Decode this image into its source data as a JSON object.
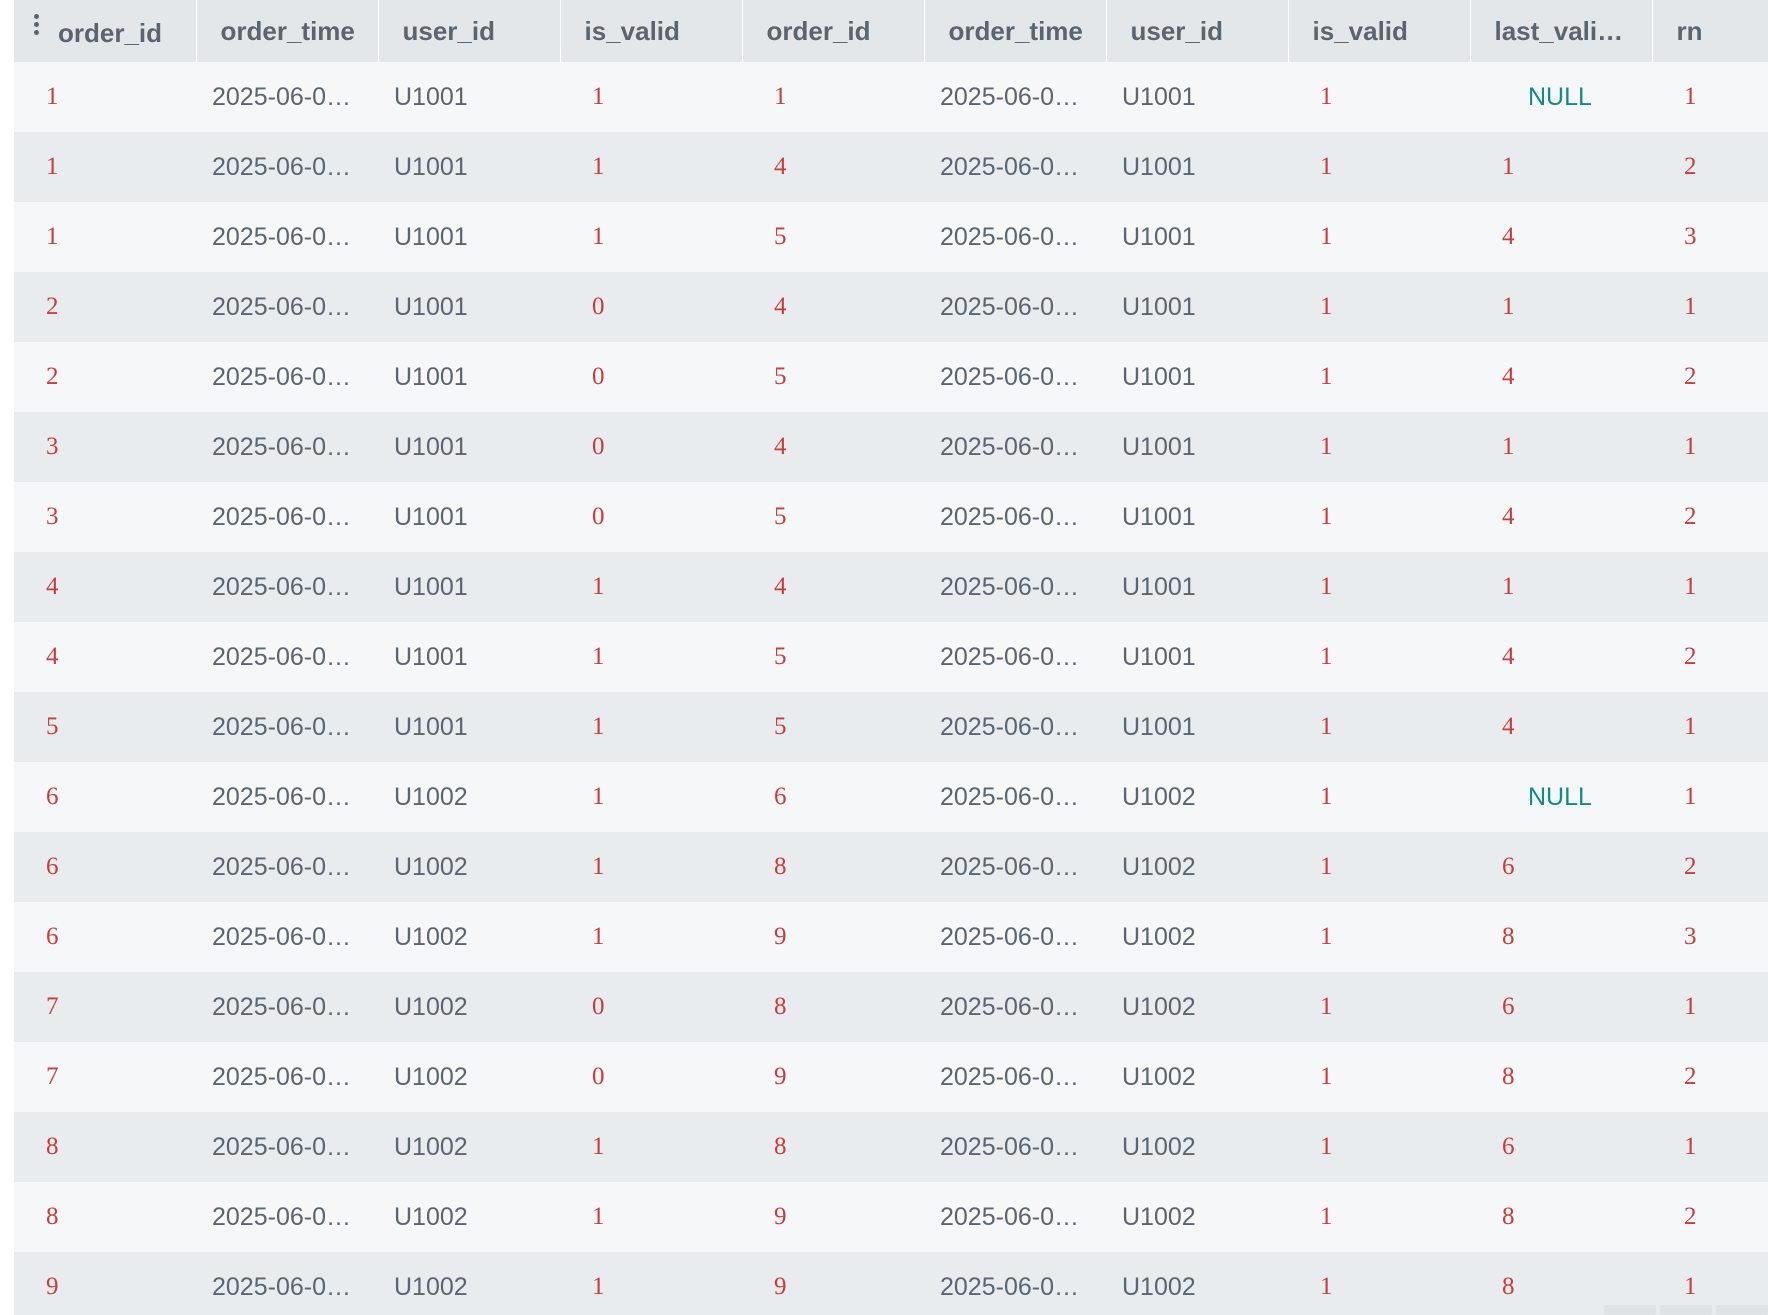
{
  "columns": [
    "order_id",
    "order_time",
    "user_id",
    "is_valid",
    "order_id",
    "order_time",
    "user_id",
    "is_valid",
    "last_vali…",
    "rn"
  ],
  "column_types": [
    "num",
    "txt",
    "txt",
    "num",
    "num",
    "txt",
    "txt",
    "num",
    "num",
    "num"
  ],
  "null_label": "NULL",
  "colors": {
    "number": "#cc3b3b",
    "text": "#5b6570",
    "null": "#138a8a",
    "header_bg": "#e4e7ea"
  },
  "rows": [
    [
      "1",
      "2025-06-0…",
      "U1001",
      "1",
      "1",
      "2025-06-0…",
      "U1001",
      "1",
      null,
      "1"
    ],
    [
      "1",
      "2025-06-0…",
      "U1001",
      "1",
      "4",
      "2025-06-0…",
      "U1001",
      "1",
      "1",
      "2"
    ],
    [
      "1",
      "2025-06-0…",
      "U1001",
      "1",
      "5",
      "2025-06-0…",
      "U1001",
      "1",
      "4",
      "3"
    ],
    [
      "2",
      "2025-06-0…",
      "U1001",
      "0",
      "4",
      "2025-06-0…",
      "U1001",
      "1",
      "1",
      "1"
    ],
    [
      "2",
      "2025-06-0…",
      "U1001",
      "0",
      "5",
      "2025-06-0…",
      "U1001",
      "1",
      "4",
      "2"
    ],
    [
      "3",
      "2025-06-0…",
      "U1001",
      "0",
      "4",
      "2025-06-0…",
      "U1001",
      "1",
      "1",
      "1"
    ],
    [
      "3",
      "2025-06-0…",
      "U1001",
      "0",
      "5",
      "2025-06-0…",
      "U1001",
      "1",
      "4",
      "2"
    ],
    [
      "4",
      "2025-06-0…",
      "U1001",
      "1",
      "4",
      "2025-06-0…",
      "U1001",
      "1",
      "1",
      "1"
    ],
    [
      "4",
      "2025-06-0…",
      "U1001",
      "1",
      "5",
      "2025-06-0…",
      "U1001",
      "1",
      "4",
      "2"
    ],
    [
      "5",
      "2025-06-0…",
      "U1001",
      "1",
      "5",
      "2025-06-0…",
      "U1001",
      "1",
      "4",
      "1"
    ],
    [
      "6",
      "2025-06-0…",
      "U1002",
      "1",
      "6",
      "2025-06-0…",
      "U1002",
      "1",
      null,
      "1"
    ],
    [
      "6",
      "2025-06-0…",
      "U1002",
      "1",
      "8",
      "2025-06-0…",
      "U1002",
      "1",
      "6",
      "2"
    ],
    [
      "6",
      "2025-06-0…",
      "U1002",
      "1",
      "9",
      "2025-06-0…",
      "U1002",
      "1",
      "8",
      "3"
    ],
    [
      "7",
      "2025-06-0…",
      "U1002",
      "0",
      "8",
      "2025-06-0…",
      "U1002",
      "1",
      "6",
      "1"
    ],
    [
      "7",
      "2025-06-0…",
      "U1002",
      "0",
      "9",
      "2025-06-0…",
      "U1002",
      "1",
      "8",
      "2"
    ],
    [
      "8",
      "2025-06-0…",
      "U1002",
      "1",
      "8",
      "2025-06-0…",
      "U1002",
      "1",
      "6",
      "1"
    ],
    [
      "8",
      "2025-06-0…",
      "U1002",
      "1",
      "9",
      "2025-06-0…",
      "U1002",
      "1",
      "8",
      "2"
    ],
    [
      "9",
      "2025-06-0…",
      "U1002",
      "1",
      "9",
      "2025-06-0…",
      "U1002",
      "1",
      "8",
      "1"
    ]
  ]
}
